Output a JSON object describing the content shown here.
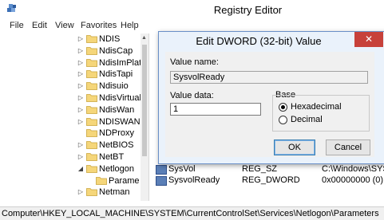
{
  "window": {
    "title": "Registry Editor",
    "app_icon": "registry-icon"
  },
  "menu": [
    "File",
    "Edit",
    "View",
    "Favorites",
    "Help"
  ],
  "tree": {
    "items": [
      {
        "label": "NDIS",
        "arrow": "▷"
      },
      {
        "label": "NdisCap",
        "arrow": "▷"
      },
      {
        "label": "NdisImPlat",
        "arrow": "▷"
      },
      {
        "label": "NdisTapi",
        "arrow": "▷"
      },
      {
        "label": "Ndisuio",
        "arrow": "▷"
      },
      {
        "label": "NdisVirtual",
        "arrow": "▷"
      },
      {
        "label": "NdisWan",
        "arrow": "▷"
      },
      {
        "label": "NDISWANL",
        "arrow": "▷"
      },
      {
        "label": "NDProxy",
        "arrow": ""
      },
      {
        "label": "NetBIOS",
        "arrow": "▷"
      },
      {
        "label": "NetBT",
        "arrow": "▷"
      },
      {
        "label": "Netlogon",
        "arrow": "◢"
      },
      {
        "label": "Parame",
        "arrow": ""
      },
      {
        "label": "Netman",
        "arrow": "▷"
      }
    ]
  },
  "values": {
    "rows": [
      {
        "name": "SysvolReady",
        "type": "REG_DWORD",
        "data": "0x00000000 (0)"
      }
    ],
    "partial_row": {
      "name": "SysVol",
      "type": "REG_SZ",
      "data": "C:\\Windows\\SYSVO"
    }
  },
  "status_bar": {
    "path": "Computer\\HKEY_LOCAL_MACHINE\\SYSTEM\\CurrentControlSet\\Services\\Netlogon\\Parameters"
  },
  "dialog": {
    "title": "Edit DWORD (32-bit) Value",
    "close_glyph": "✕",
    "value_name_label": "Value name:",
    "value_name": "SysvolReady",
    "value_data_label": "Value data:",
    "value_data": "1",
    "base_label": "Base",
    "base_options": [
      {
        "label": "Hexadecimal",
        "checked": true
      },
      {
        "label": "Decimal",
        "checked": false
      }
    ],
    "ok_label": "OK",
    "cancel_label": "Cancel"
  }
}
